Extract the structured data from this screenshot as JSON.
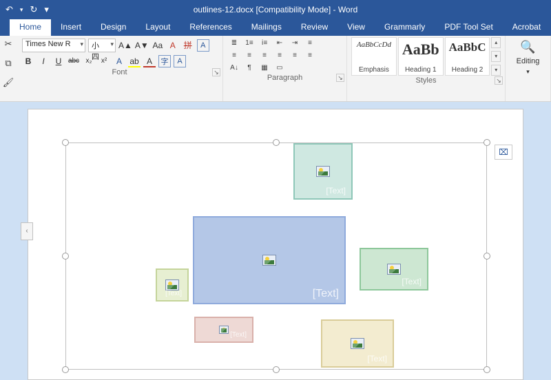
{
  "app": {
    "title": "outlines-12.docx [Compatibility Mode] - Word"
  },
  "qa": {
    "undo": "↶",
    "redo": "↻",
    "customize": "▾"
  },
  "tabs": [
    "Home",
    "Insert",
    "Design",
    "Layout",
    "References",
    "Mailings",
    "Review",
    "View",
    "Grammarly",
    "PDF Tool Set",
    "Acrobat"
  ],
  "active_tab": 0,
  "clipboard": {
    "cut": "✂",
    "copy": "⧉",
    "paint": "🖌"
  },
  "font": {
    "family": "Times New R",
    "size": "小四",
    "grow": "A▲",
    "shrink": "A▼",
    "case": "Aa",
    "clear": "A",
    "bold": "B",
    "italic": "I",
    "underline": "U",
    "strike": "abc",
    "sub": "x₂",
    "sup": "x²",
    "effects": "A",
    "highlight": "ab",
    "color": "A",
    "enclose": "字",
    "charborder": "A",
    "label": "Font"
  },
  "paragraph": {
    "bullets": "≣",
    "numbers": "1≡",
    "ml": "ⅰ≡",
    "dec": "⇤",
    "inc": "⇥",
    "aligndist": "≡",
    "sort": "A↓",
    "marks": "¶",
    "al": "≡",
    "ac": "≡",
    "ar": "≡",
    "aj": "≡",
    "ad": "≡",
    "ls": "≡",
    "shd": "▦",
    "brd": "▭",
    "label": "Paragraph"
  },
  "styles": {
    "items": [
      {
        "preview": "AaBbCcDd",
        "name": "Emphasis",
        "size": "11px"
      },
      {
        "preview": "AaBb",
        "name": "Heading 1",
        "size": "22px"
      },
      {
        "preview": "AaBbC",
        "name": "Heading 2",
        "size": "17px"
      }
    ],
    "label": "Styles"
  },
  "editing": {
    "find": "🔍",
    "label": "Editing"
  },
  "launcher": "↘",
  "canvas": {
    "margin_tab": "‹",
    "layout_options": "⌧",
    "placeholder": "[Text]"
  }
}
